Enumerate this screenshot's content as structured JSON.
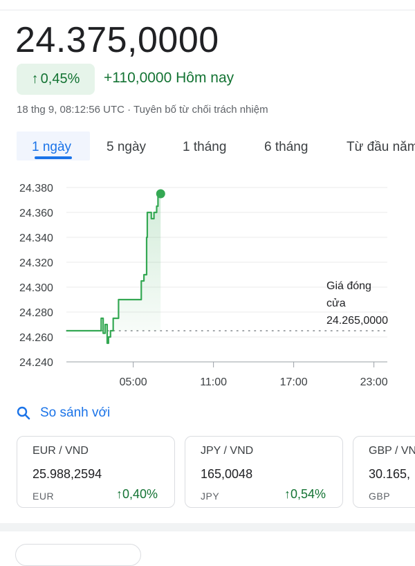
{
  "quote": {
    "price": "24.375,0000",
    "change_percent": "0,45%",
    "change_abs": "+110,0000 Hôm nay",
    "timestamp": "18 thg 9, 08:12:56 UTC · Tuyên bố từ chối trách nhiệm"
  },
  "tabs": [
    "1 ngày",
    "5 ngày",
    "1 tháng",
    "6 tháng",
    "Từ đầu năm"
  ],
  "active_tab": "1 ngày",
  "compare": {
    "label": "So sánh với"
  },
  "colors": {
    "up": "#137333",
    "line": "#34a853",
    "accent": "#1a73e8"
  },
  "chart_data": {
    "type": "line",
    "ylim": [
      24240,
      24380
    ],
    "y_ticks": [
      "24.380",
      "24.360",
      "24.340",
      "24.320",
      "24.300",
      "24.280",
      "24.260",
      "24.240"
    ],
    "x_ticks": [
      "05:00",
      "11:00",
      "17:00",
      "23:00"
    ],
    "previous_close": {
      "value": 24265,
      "label_lines": [
        "Giá đóng",
        "cửa",
        "24.265,0000"
      ]
    },
    "series": [
      {
        "points": [
          [
            0.0,
            24265
          ],
          [
            2.5,
            24265
          ],
          [
            2.6,
            24275
          ],
          [
            2.7,
            24275
          ],
          [
            2.75,
            24263
          ],
          [
            2.85,
            24263
          ],
          [
            2.9,
            24270
          ],
          [
            3.0,
            24270
          ],
          [
            3.05,
            24255
          ],
          [
            3.15,
            24260
          ],
          [
            3.3,
            24265
          ],
          [
            3.4,
            24265
          ],
          [
            3.5,
            24275
          ],
          [
            3.8,
            24275
          ],
          [
            3.9,
            24290
          ],
          [
            5.5,
            24290
          ],
          [
            5.6,
            24305
          ],
          [
            5.8,
            24310
          ],
          [
            6.0,
            24340
          ],
          [
            6.05,
            24360
          ],
          [
            6.2,
            24360
          ],
          [
            6.35,
            24355
          ],
          [
            6.55,
            24360
          ],
          [
            6.75,
            24365
          ],
          [
            6.85,
            24375
          ],
          [
            7.05,
            24375
          ]
        ]
      }
    ]
  },
  "cards": [
    {
      "pair": "EUR / VND",
      "value": "25.988,2594",
      "currency": "EUR",
      "change": "0,40%"
    },
    {
      "pair": "JPY / VND",
      "value": "165,0048",
      "currency": "JPY",
      "change": "0,54%"
    },
    {
      "pair": "GBP / VND",
      "value": "30.165,",
      "currency": "GBP",
      "change": ""
    }
  ]
}
